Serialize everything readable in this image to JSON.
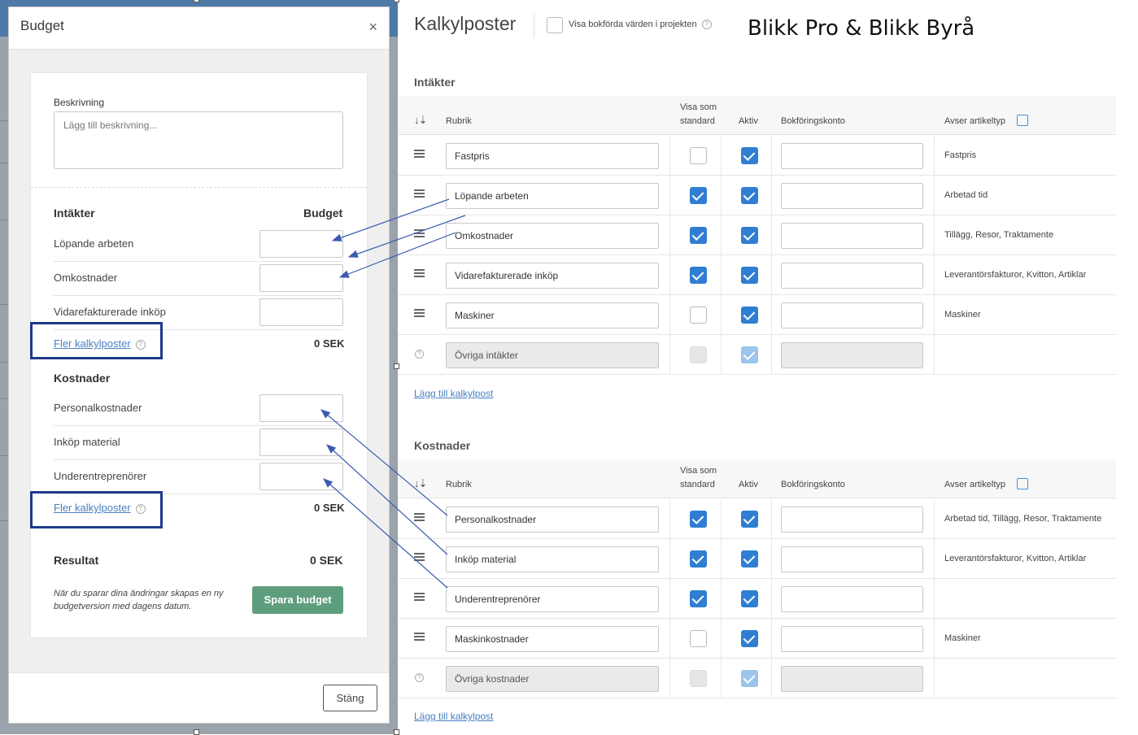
{
  "modal": {
    "title": "Budget",
    "close_symbol": "×",
    "description_label": "Beskrivning",
    "description_placeholder": "Lägg till beskrivning...",
    "revenue_heading": "Intäkter",
    "budget_heading": "Budget",
    "revenue_rows": [
      {
        "label": "Löpande arbeten"
      },
      {
        "label": "Omkostnader"
      },
      {
        "label": "Vidarefakturerade inköp"
      }
    ],
    "revenue_more_link": "Fler kalkylposter",
    "revenue_total": "0 SEK",
    "cost_heading": "Kostnader",
    "cost_rows": [
      {
        "label": "Personalkostnader"
      },
      {
        "label": "Inköp material"
      },
      {
        "label": "Underentreprenörer"
      }
    ],
    "cost_more_link": "Fler kalkylposter",
    "cost_total": "0 SEK",
    "result_label": "Resultat",
    "result_value": "0 SEK",
    "save_note": "När du sparar dina ändringar skapas en ny budgetversion med dagens datum.",
    "save_button": "Spara budget",
    "close_button": "Stäng",
    "help_symbol": "?"
  },
  "settings": {
    "title": "Kalkylposter",
    "show_booked_label": "Visa bokförda värden i projekten",
    "brand_caption": "Blikk Pro & Blikk Byrå",
    "columns": {
      "rubrik": "Rubrik",
      "visa_line1": "Visa som",
      "visa_line2": "standard",
      "aktiv": "Aktiv",
      "konto": "Bokföringskonto",
      "artikeltyp": "Avser artikeltyp"
    },
    "revenue": {
      "heading": "Intäkter",
      "rows": [
        {
          "name": "Fastpris",
          "standard": false,
          "aktiv": true,
          "artikeltyp": "Fastpris",
          "locked": false
        },
        {
          "name": "Löpande arbeten",
          "standard": true,
          "aktiv": true,
          "artikeltyp": "Arbetad tid",
          "locked": false
        },
        {
          "name": "Omkostnader",
          "standard": true,
          "aktiv": true,
          "artikeltyp": "Tillägg, Resor, Traktamente",
          "locked": false
        },
        {
          "name": "Vidarefakturerade inköp",
          "standard": true,
          "aktiv": true,
          "artikeltyp": "Leverantörsfakturor, Kvitton, Artiklar",
          "locked": false
        },
        {
          "name": "Maskiner",
          "standard": false,
          "aktiv": true,
          "artikeltyp": "Maskiner",
          "locked": false
        },
        {
          "name": "Övriga intäkter",
          "standard": false,
          "aktiv": true,
          "artikeltyp": "",
          "locked": true
        }
      ],
      "add_link": "Lägg till kalkylpost"
    },
    "costs": {
      "heading": "Kostnader",
      "rows": [
        {
          "name": "Personalkostnader",
          "standard": true,
          "aktiv": true,
          "artikeltyp": "Arbetad tid, Tillägg, Resor, Traktamente",
          "locked": false
        },
        {
          "name": "Inköp material",
          "standard": true,
          "aktiv": true,
          "artikeltyp": "Leverantörsfakturor, Kvitton, Artiklar",
          "locked": false
        },
        {
          "name": "Underentreprenörer",
          "standard": true,
          "aktiv": true,
          "artikeltyp": "",
          "locked": false
        },
        {
          "name": "Maskinkostnader",
          "standard": false,
          "aktiv": true,
          "artikeltyp": "Maskiner",
          "locked": false
        },
        {
          "name": "Övriga kostnader",
          "standard": false,
          "aktiv": true,
          "artikeltyp": "",
          "locked": true
        }
      ],
      "add_link": "Lägg till kalkylpost"
    }
  },
  "colors": {
    "accent_blue": "#2f7ed2",
    "annotation_arrow": "#3b5bb0",
    "highlight_border": "#1e3a8a",
    "save_button": "#5e9e7c"
  }
}
